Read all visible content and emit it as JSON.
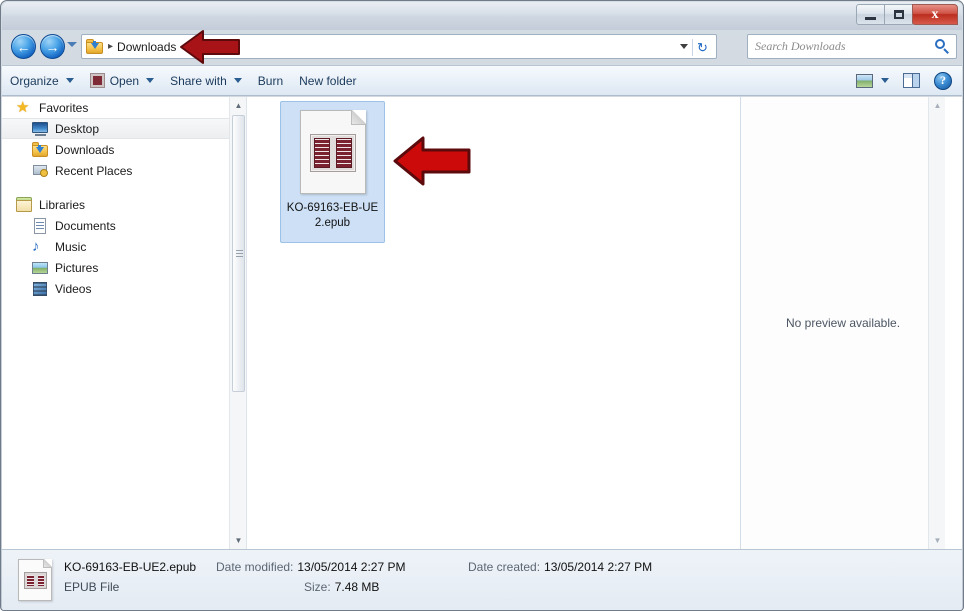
{
  "window": {
    "title": "",
    "controls": {
      "minimize": "minimize",
      "maximize": "maximize",
      "close": "x"
    }
  },
  "addressbar": {
    "back_glyph": "←",
    "forward_glyph": "→",
    "folder_icon": "downloads-folder-icon",
    "separator": "▸",
    "crumb": "Downloads",
    "dropdown_icon": "chevron-down-icon",
    "refresh_glyph": "↻",
    "refresh_icon": "refresh-icon"
  },
  "search": {
    "placeholder": "Search Downloads",
    "value": "",
    "icon": "search-icon"
  },
  "toolbar": {
    "items": [
      {
        "label": "Organize",
        "has_caret": true,
        "icon": null
      },
      {
        "label": "Open",
        "has_caret": true,
        "icon": "epub-file-icon"
      },
      {
        "label": "Share with",
        "has_caret": true,
        "icon": null
      },
      {
        "label": "Burn",
        "has_caret": false,
        "icon": null
      },
      {
        "label": "New folder",
        "has_caret": false,
        "icon": null
      }
    ],
    "right": {
      "view_icon": "view-layout-icon",
      "view_caret": "chevron-down-icon",
      "preview_pane_icon": "preview-pane-icon",
      "help_icon": "help-icon",
      "help_glyph": "?"
    }
  },
  "sidebar": {
    "groups": [
      {
        "header": {
          "label": "Favorites",
          "icon": "star-icon"
        },
        "items": [
          {
            "label": "Desktop",
            "icon": "desktop-icon",
            "selected": true
          },
          {
            "label": "Downloads",
            "icon": "downloads-folder-icon",
            "selected": false
          },
          {
            "label": "Recent Places",
            "icon": "recent-places-icon",
            "selected": false
          }
        ]
      },
      {
        "header": {
          "label": "Libraries",
          "icon": "libraries-icon"
        },
        "items": [
          {
            "label": "Documents",
            "icon": "documents-icon",
            "selected": false
          },
          {
            "label": "Music",
            "icon": "music-icon",
            "selected": false
          },
          {
            "label": "Pictures",
            "icon": "pictures-icon",
            "selected": false
          },
          {
            "label": "Videos",
            "icon": "videos-icon",
            "selected": false
          }
        ]
      }
    ],
    "scrollbar": {
      "up_glyph": "▲",
      "down_glyph": "▼"
    }
  },
  "content": {
    "files": [
      {
        "name_line1": "KO-69163-EB-UE",
        "name_line2": "2.epub",
        "icon": "epub-file-icon",
        "selected": true
      }
    ]
  },
  "preview": {
    "message": "No preview available.",
    "scrollbar": {
      "up_glyph": "▲",
      "down_glyph": "▼"
    }
  },
  "statusbar": {
    "file_icon": "epub-file-icon",
    "file_name": "KO-69163-EB-UE2.epub",
    "file_type": "EPUB File",
    "date_modified_label": "Date modified:",
    "date_modified_value": "13/05/2014 2:27 PM",
    "size_label": "Size:",
    "size_value": "7.48 MB",
    "date_created_label": "Date created:",
    "date_created_value": "13/05/2014 2:27 PM"
  },
  "annotations": {
    "arrows": [
      {
        "name": "address-bar-arrow",
        "color": "#a81318",
        "outline": "#5d0a0c"
      },
      {
        "name": "file-icon-arrow",
        "color": "#cc0a0a",
        "outline": "#5d0a0c"
      }
    ]
  }
}
